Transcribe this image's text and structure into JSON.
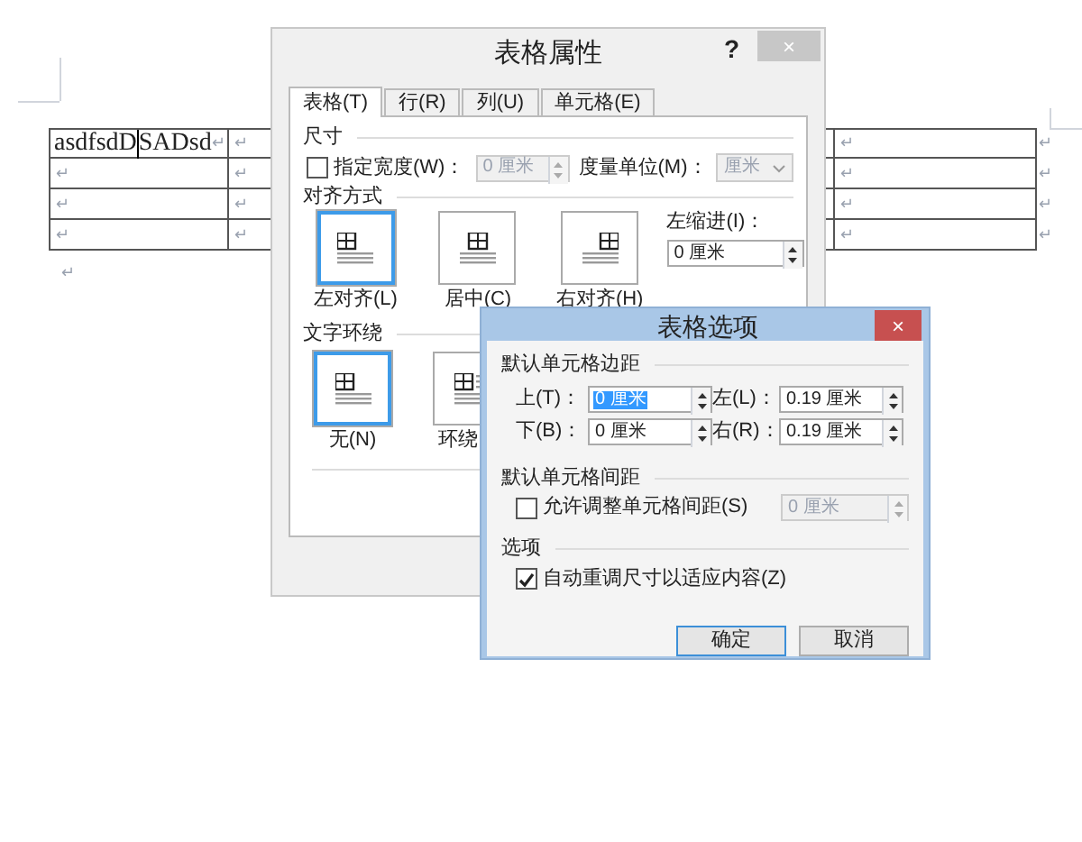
{
  "document": {
    "table": {
      "rows": [
        {
          "cells": [
            {
              "text": "asdfsdD",
              "text_after_cursor": "SADsd",
              "mark": "↵"
            },
            {
              "mark": "↵"
            },
            {
              "mark": "↵"
            }
          ],
          "end_mark": "↵"
        },
        {
          "cells": [
            {
              "mark": "↵"
            },
            {
              "mark": "↵"
            },
            {
              "mark": "↵"
            }
          ],
          "end_mark": "↵"
        },
        {
          "cells": [
            {
              "mark": "↵"
            },
            {
              "mark": "↵"
            },
            {
              "mark": "↵"
            }
          ],
          "end_mark": "↵"
        },
        {
          "cells": [
            {
              "mark": "↵"
            },
            {
              "mark": "↵"
            },
            {
              "mark": "↵"
            }
          ],
          "end_mark": "↵"
        }
      ]
    },
    "after_table_mark": "↵"
  },
  "table_properties": {
    "title": "表格属性",
    "help": "?",
    "close": "×",
    "tabs": [
      {
        "label": "表格(T)",
        "selected": true
      },
      {
        "label": "行(R)",
        "selected": false
      },
      {
        "label": "列(U)",
        "selected": false
      },
      {
        "label": "单元格(E)",
        "selected": false
      }
    ],
    "size": {
      "heading": "尺寸",
      "preferred_width": {
        "label": "指定宽度(W)：",
        "checked": false,
        "value": "0 厘米",
        "disabled": true
      },
      "unit": {
        "label": "度量单位(M)：",
        "value": "厘米",
        "disabled": true
      }
    },
    "alignment": {
      "heading": "对齐方式",
      "options": [
        {
          "label": "左对齐(L)",
          "kind": "left",
          "selected": true
        },
        {
          "label": "居中(C)",
          "kind": "center",
          "selected": false
        },
        {
          "label": "右对齐(H)",
          "kind": "right",
          "selected": false
        }
      ],
      "indent": {
        "label": "左缩进(I)：",
        "value": "0 厘米"
      }
    },
    "wrapping": {
      "heading": "文字环绕",
      "options": [
        {
          "label": "无(N)",
          "kind": "none",
          "selected": true
        },
        {
          "label": "环绕",
          "kind": "around",
          "selected": false
        }
      ]
    }
  },
  "table_options": {
    "title": "表格选项",
    "close": "×",
    "margins": {
      "heading": "默认单元格边距",
      "fields": [
        {
          "label": "上(T)：",
          "value": "0 厘米",
          "selected": true
        },
        {
          "label": "左(L)：",
          "value": "0.19 厘米",
          "selected": false
        },
        {
          "label": "下(B)：",
          "value": "0 厘米",
          "selected": false
        },
        {
          "label": "右(R)：",
          "value": "0.19 厘米",
          "selected": false
        }
      ]
    },
    "spacing": {
      "heading": "默认单元格间距",
      "checkbox": {
        "label": "允许调整单元格间距(S)",
        "checked": false
      },
      "value": "0 厘米",
      "disabled": true
    },
    "options": {
      "heading": "选项",
      "checkbox": {
        "label": "自动重调尺寸以适应内容(Z)",
        "checked": true
      }
    },
    "buttons": [
      {
        "label": "确定",
        "default": true
      },
      {
        "label": "取消",
        "default": false
      }
    ]
  }
}
